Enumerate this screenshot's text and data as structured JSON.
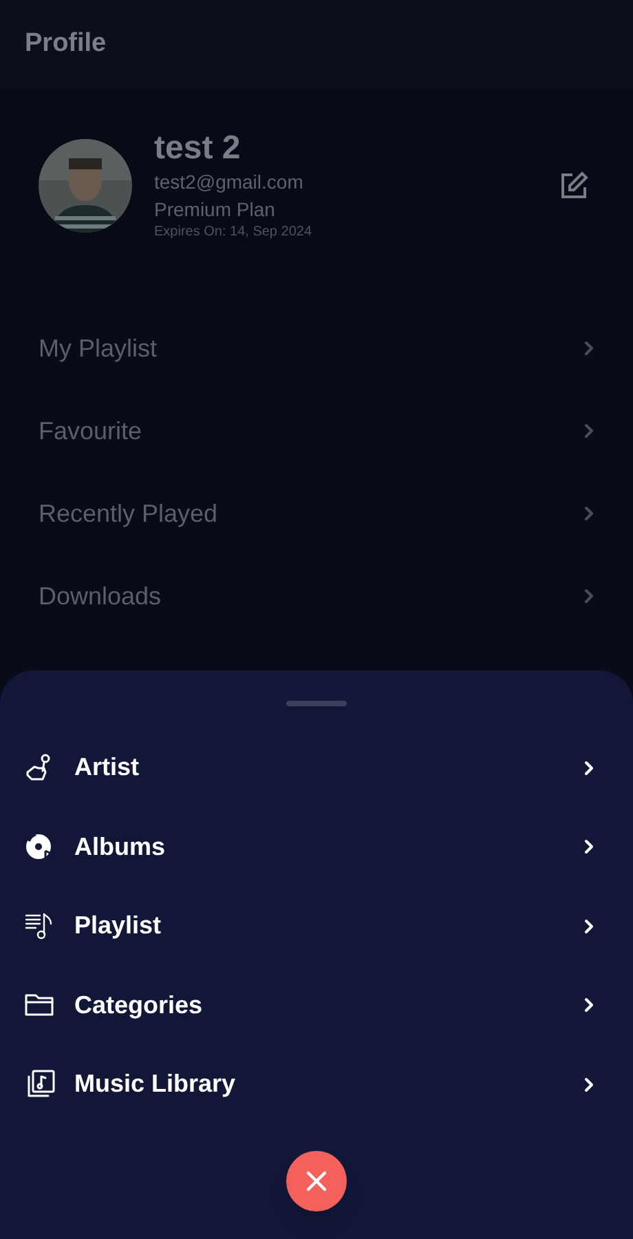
{
  "header": {
    "title": "Profile"
  },
  "profile": {
    "name": "test 2",
    "email": "test2@gmail.com",
    "plan": "Premium Plan",
    "expiry": "Expires On: 14, Sep 2024"
  },
  "menu": [
    {
      "label": "My Playlist"
    },
    {
      "label": "Favourite"
    },
    {
      "label": "Recently Played"
    },
    {
      "label": "Downloads"
    }
  ],
  "sheet": {
    "items": [
      {
        "label": "Artist",
        "kind": "artist"
      },
      {
        "label": "Albums",
        "kind": "albums"
      },
      {
        "label": "Playlist",
        "kind": "playlist"
      },
      {
        "label": "Categories",
        "kind": "categories"
      },
      {
        "label": "Music Library",
        "kind": "library"
      }
    ]
  }
}
